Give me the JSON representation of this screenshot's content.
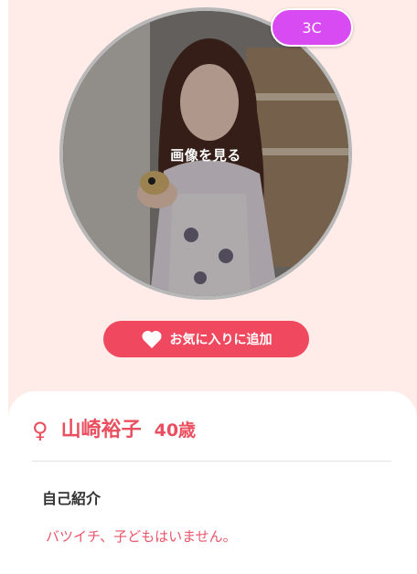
{
  "badge": {
    "label": "3C"
  },
  "photo": {
    "view_label": "画像を見る"
  },
  "favorite": {
    "label": "お気に入りに追加",
    "icon": "heart-icon"
  },
  "profile": {
    "gender_icon": "♀",
    "name": "山崎裕子",
    "age": "40歳",
    "intro_heading": "自己紹介",
    "intro_text": "バツイチ、子どもはいません。"
  },
  "colors": {
    "accent": "#f0495f",
    "name_color": "#e94f5f",
    "badge": "#d94bf2",
    "background": "#ffece8"
  }
}
